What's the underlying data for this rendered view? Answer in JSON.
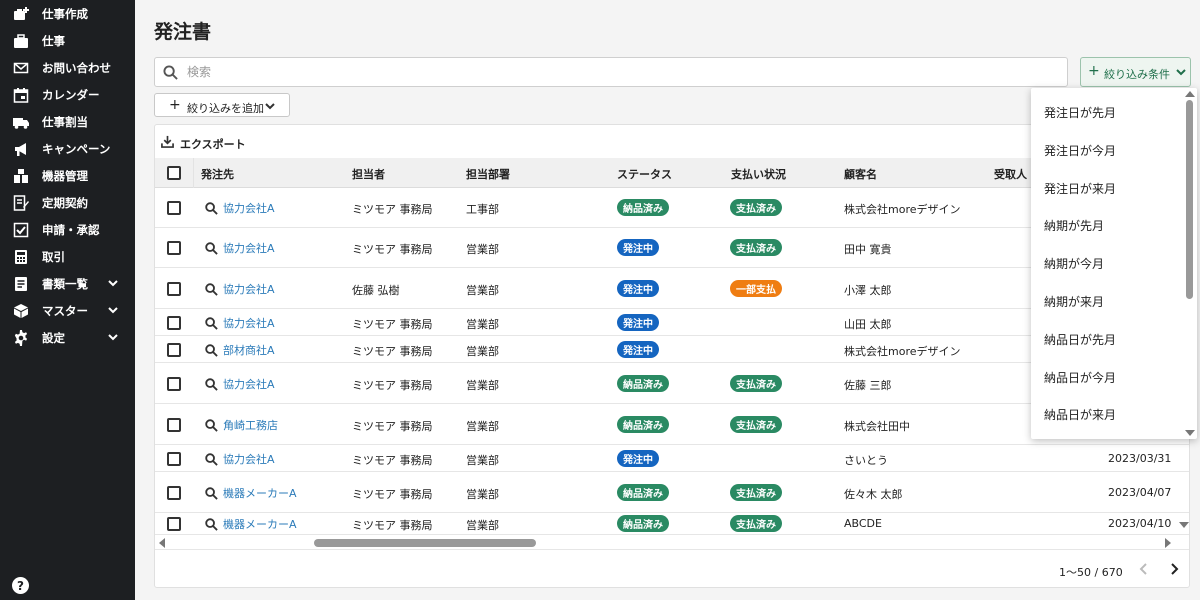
{
  "sidebar": {
    "items": [
      {
        "label": "仕事作成",
        "icon": "briefcase-plus-icon",
        "expandable": false
      },
      {
        "label": "仕事",
        "icon": "briefcase-icon",
        "expandable": false
      },
      {
        "label": "お問い合わせ",
        "icon": "mail-icon",
        "expandable": false
      },
      {
        "label": "カレンダー",
        "icon": "calendar-icon",
        "expandable": false
      },
      {
        "label": "仕事割当",
        "icon": "truck-icon",
        "expandable": false
      },
      {
        "label": "キャンペーン",
        "icon": "megaphone-icon",
        "expandable": false
      },
      {
        "label": "機器管理",
        "icon": "equipment-icon",
        "expandable": false
      },
      {
        "label": "定期契約",
        "icon": "contract-icon",
        "expandable": false
      },
      {
        "label": "申請・承認",
        "icon": "checkbox-icon",
        "expandable": false
      },
      {
        "label": "取引",
        "icon": "calculator-icon",
        "expandable": false
      },
      {
        "label": "書類一覧",
        "icon": "document-icon",
        "expandable": true
      },
      {
        "label": "マスター",
        "icon": "cube-icon",
        "expandable": true
      },
      {
        "label": "設定",
        "icon": "gear-icon",
        "expandable": true
      }
    ],
    "help_label": "?"
  },
  "page": {
    "title": "発注書"
  },
  "search": {
    "placeholder": "検索",
    "value": ""
  },
  "filter_conditions": {
    "label": "絞り込み条件"
  },
  "add_filter": {
    "label": "絞り込みを追加"
  },
  "export": {
    "label": "エクスポート"
  },
  "table": {
    "columns": [
      "発注先",
      "担当者",
      "担当部署",
      "ステータス",
      "支払い状況",
      "顧客名",
      "受取人"
    ],
    "rows": [
      {
        "vendor": "協力会社A",
        "person": "ミツモア 事務局",
        "dept": "工事部",
        "status": "納品済み",
        "payment": "支払済み",
        "customer": "株式会社moreデザイン",
        "date": ""
      },
      {
        "vendor": "協力会社A",
        "person": "ミツモア 事務局",
        "dept": "営業部",
        "status": "発注中",
        "payment": "支払済み",
        "customer": "田中 寛貴",
        "date": ""
      },
      {
        "vendor": "協力会社A",
        "person": "佐藤 弘樹",
        "dept": "営業部",
        "status": "発注中",
        "payment": "一部支払",
        "customer": "小澤 太郎",
        "date": ""
      },
      {
        "vendor": "協力会社A",
        "person": "ミツモア 事務局",
        "dept": "営業部",
        "status": "発注中",
        "payment": "",
        "customer": "山田 太郎",
        "date": ""
      },
      {
        "vendor": "部材商社A",
        "person": "ミツモア 事務局",
        "dept": "営業部",
        "status": "発注中",
        "payment": "",
        "customer": "株式会社moreデザイン",
        "date": ""
      },
      {
        "vendor": "協力会社A",
        "person": "ミツモア 事務局",
        "dept": "営業部",
        "status": "納品済み",
        "payment": "支払済み",
        "customer": "佐藤 三郎",
        "date": ""
      },
      {
        "vendor": "角崎工務店",
        "person": "ミツモア 事務局",
        "dept": "営業部",
        "status": "納品済み",
        "payment": "支払済み",
        "customer": "株式会社田中",
        "date": ""
      },
      {
        "vendor": "協力会社A",
        "person": "ミツモア 事務局",
        "dept": "営業部",
        "status": "発注中",
        "payment": "",
        "customer": "さいとう",
        "date": "2023/03/31"
      },
      {
        "vendor": "機器メーカーA",
        "person": "ミツモア 事務局",
        "dept": "営業部",
        "status": "納品済み",
        "payment": "支払済み",
        "customer": "佐々木 太郎",
        "date": "2023/04/07"
      },
      {
        "vendor": "機器メーカーA",
        "person": "ミツモア 事務局",
        "dept": "営業部",
        "status": "納品済み",
        "payment": "支払済み",
        "customer": "ABCDE",
        "date": "2023/04/10"
      }
    ]
  },
  "status_colors": {
    "納品済み": "#2a8a63",
    "発注中": "#1565c0",
    "支払済み": "#2a8a63",
    "一部支払": "#ef7d12"
  },
  "pagination": {
    "range": "1〜50 / 670"
  },
  "dropdown": {
    "options": [
      "発注日が先月",
      "発注日が今月",
      "発注日が来月",
      "納期が先月",
      "納期が今月",
      "納期が来月",
      "納品日が先月",
      "納品日が今月",
      "納品日が来月"
    ]
  }
}
